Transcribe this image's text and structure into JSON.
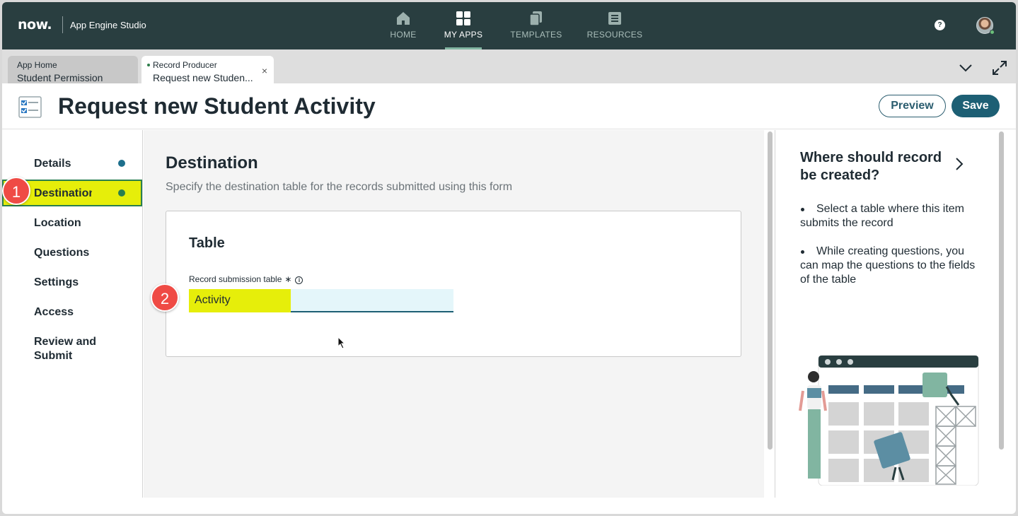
{
  "topnav": {
    "logo": "now.",
    "app_title": "App Engine Studio",
    "items": [
      {
        "label": "HOME",
        "icon": "home-icon",
        "active": false
      },
      {
        "label": "MY APPS",
        "icon": "grid-icon",
        "active": true
      },
      {
        "label": "TEMPLATES",
        "icon": "templates-icon",
        "active": false
      },
      {
        "label": "RESOURCES",
        "icon": "resources-icon",
        "active": false
      }
    ],
    "help": "?"
  },
  "tabs": [
    {
      "kicker": "App Home",
      "label": "Student Permission"
    },
    {
      "kicker": "Record Producer",
      "label": "Request new Studen...",
      "close": "×"
    }
  ],
  "header": {
    "title": "Request new Student Activity",
    "preview_label": "Preview",
    "save_label": "Save"
  },
  "steps": [
    {
      "label": "Details",
      "dot": true,
      "dot_color": "#1d6f8c"
    },
    {
      "label": "Destination",
      "dot": true,
      "dot_color": "#2a7f4f",
      "highlighted": true
    },
    {
      "label": "Location"
    },
    {
      "label": "Questions"
    },
    {
      "label": "Settings"
    },
    {
      "label": "Access"
    },
    {
      "label": "Review and Submit"
    }
  ],
  "annotations": {
    "badge1": "1",
    "badge2": "2",
    "highlight_color": "#e6ee0a"
  },
  "destination": {
    "title": "Destination",
    "subtitle": "Specify the destination table for the records submitted using this form",
    "card_title": "Table",
    "field_label": "Record submission table",
    "required_mark": "∗",
    "info": "i",
    "field_value": "Activity"
  },
  "help_panel": {
    "title": "Where should record be created?",
    "bullets": [
      "Select a table where this item submits the record",
      "While creating questions, you can map the questions to the fields of the table"
    ]
  },
  "colors": {
    "nav_bg": "#293e40",
    "accent": "#1d5f74",
    "badge": "#ef4b45"
  }
}
